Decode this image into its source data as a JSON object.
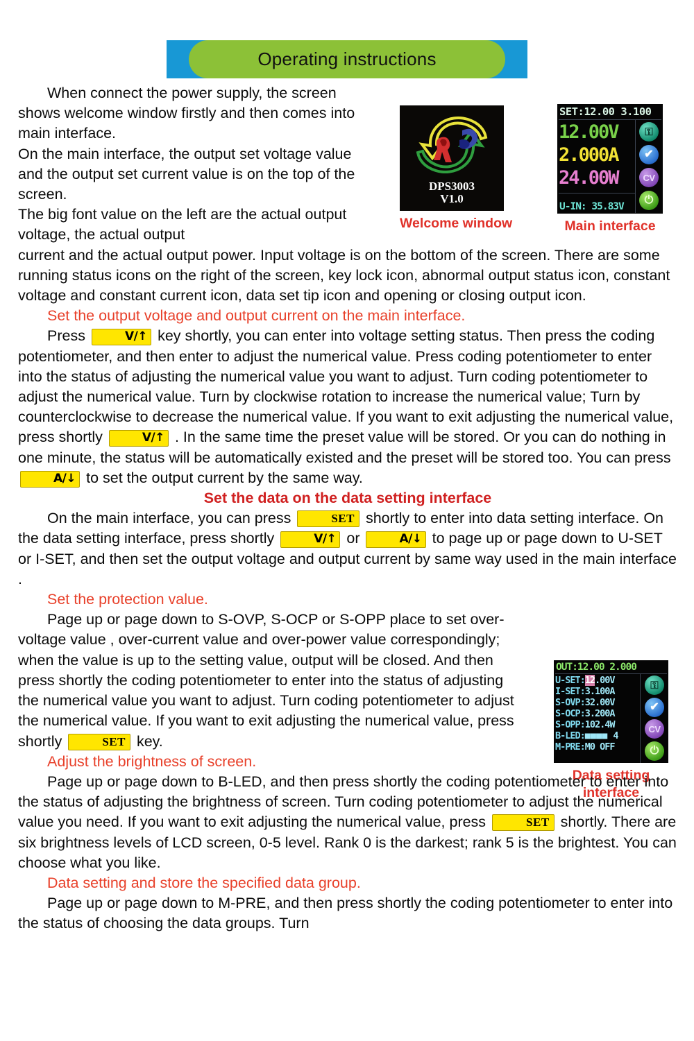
{
  "banner": {
    "title": "Operating instructions",
    "bar_color": "#1898d5",
    "pill_color": "#8cc137"
  },
  "body": {
    "p1": "When connect the power supply, the screen shows welcome window firstly and then comes into main interface.",
    "p2": "On the main interface, the output set voltage value and the output set current value is on the top of the screen.",
    "p3_a": "The big font value on the left are the actual output voltage, the actual output",
    "p3_b": "current and the actual output power. Input voltage is on the bottom of the screen. There are some running status icons on the right of the screen, key lock icon, abnormal output status icon, constant voltage and constant current icon, data set tip icon and opening or closing output icon.",
    "head_set_output": "Set the output voltage and output current on the main interface.",
    "p4_1": "Press",
    "p4_2": "key shortly, you can enter into voltage setting status. Then press the coding potentiometer, and then enter to adjust the numerical value. Press coding potentiometer to enter into the status of adjusting the numerical value you want to adjust. Turn coding potentiometer to adjust the numerical value. Turn by clockwise rotation to increase the numerical value; Turn by counterclockwise to decrease the numerical value. If you want to exit adjusting the numerical value, press shortly",
    "p4_3": ". In the same time the preset value will be stored. Or you can do nothing in one minute, the status will be automatically existed and the preset will be stored too.  You can press",
    "p4_4": "to set the output current by the same way.",
    "head_data_setting": "Set the data on the data setting interface",
    "p5_1": "On the main interface, you can press",
    "p5_2": "shortly to enter into data setting interface. On the data setting interface, press shortly",
    "p5_3": "or",
    "p5_4": "to page up or page down to U-SET or I-SET, and then set the output voltage and output current by same way used in the main interface .",
    "head_protection": "Set the protection value.",
    "p6_1": "Page up or page down to S-OVP, S-OCP or S-OPP place to set over-voltage value , over-current value and over-power value correspondingly; when the value is up to the setting value, output will be closed. And then press shortly the coding potentiometer to enter into the status of adjusting the numerical value you want to adjust. Turn coding potentiometer to adjust the numerical value. If you want to exit adjusting the numerical value, press shortly",
    "p6_2": "key.",
    "head_brightness": "Adjust the brightness of screen.",
    "p7_1": "Page up or page down to B-LED, and then press shortly the coding potentiometer to enter into the status of adjusting the brightness of screen. Turn coding potentiometer to adjust the numerical value you need. If you want to exit adjusting the numerical value, press",
    "p7_2": "shortly. There are six brightness levels of LCD screen, 0-5 level. Rank 0 is the darkest; rank 5 is the brightest. You can choose what you like.",
    "head_store_group": "Data setting and store the specified data group.",
    "p8": "Page up or page down to M-PRE, and then press shortly the coding potentiometer to enter into the status of choosing the data groups. Turn"
  },
  "keys": {
    "voltage_up": "V/↑",
    "current_down": "A/↓",
    "set": "SET"
  },
  "figures": {
    "welcome": {
      "caption": "Welcome window",
      "model": "DPS3003",
      "version": "V1.0",
      "icon_names": [
        "yellow-arrow-icon",
        "green-arrow-icon",
        "red-letter-icon",
        "blue-letter-icon"
      ]
    },
    "main_interface": {
      "caption": "Main interface",
      "topbar": "SET:12.00 3.100",
      "voltage": "12.00V",
      "current": "2.000A",
      "power": "24.00W",
      "input": "U-IN: 35.83V",
      "icons": [
        "unlock-icon",
        "check-icon",
        "cv-icon",
        "power-icon"
      ],
      "colors": {
        "topbar": "#d8f3e4",
        "voltage": "#79d14a",
        "current": "#f2e235",
        "power": "#e77fd0",
        "input": "#6ee3d4"
      }
    },
    "data_setting": {
      "caption_line1": "Data setting",
      "caption_line2": "interface",
      "topbar": "OUT:12.00 2.000",
      "rows": [
        {
          "label": "U-SET:",
          "value": "12.00V",
          "highlight": "12"
        },
        {
          "label": "I-SET:",
          "value": "3.100A"
        },
        {
          "label": "S-OVP:",
          "value": "32.00V"
        },
        {
          "label": "S-OCP:",
          "value": "3.200A"
        },
        {
          "label": "S-OPP:",
          "value": "102.4W"
        },
        {
          "label": "B-LED:",
          "value": "■■■■  4"
        },
        {
          "label": "M-PRE:",
          "value": "M0 OFF"
        }
      ],
      "icons": [
        "unlock-icon",
        "check-icon",
        "cv-icon",
        "power-icon"
      ]
    }
  },
  "glyphs": {
    "lock": "⚿",
    "check": "✔",
    "cv": "CV",
    "power": "⏻"
  }
}
